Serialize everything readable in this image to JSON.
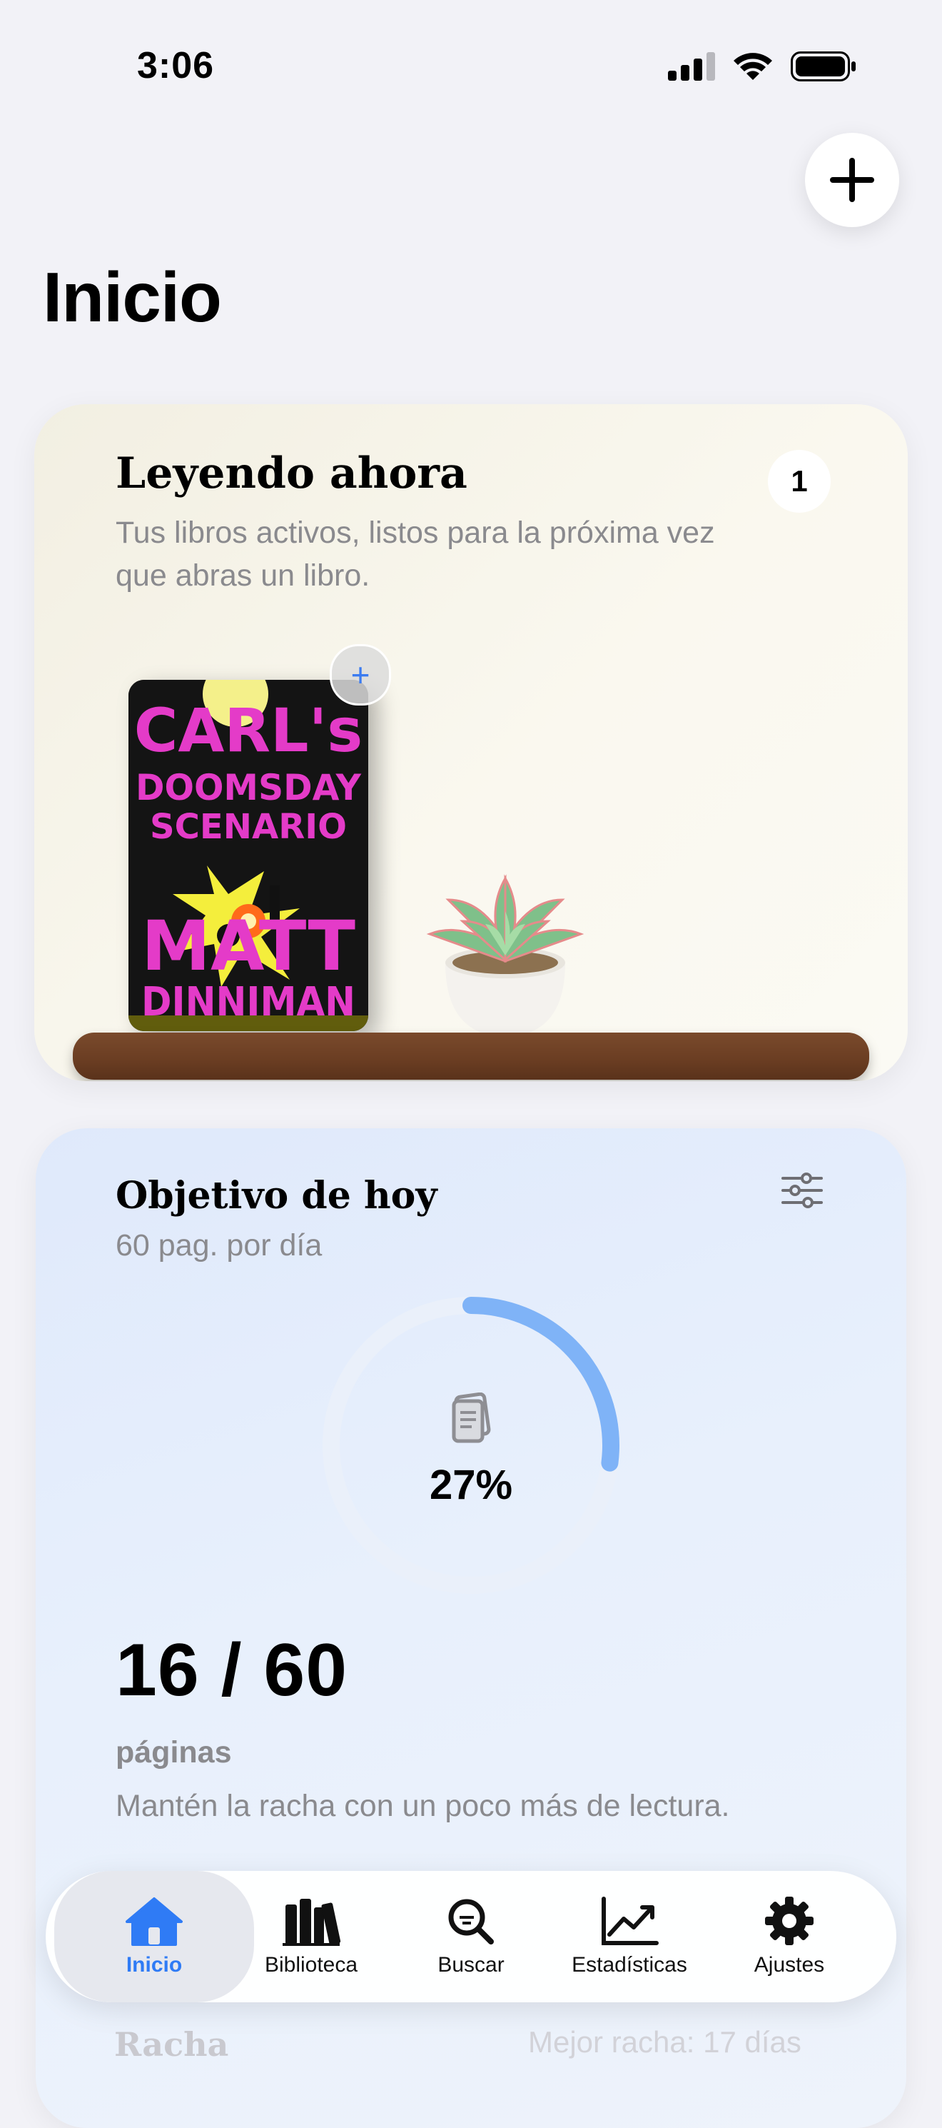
{
  "status_bar": {
    "time": "3:06"
  },
  "header": {
    "title": "Inicio"
  },
  "reading_now": {
    "title": "Leyendo ahora",
    "subtitle": "Tus libros activos, listos para la próxima vez que abras un libro.",
    "count": "1",
    "book": {
      "cover_lines": [
        "CARL's",
        "DOOMSDAY",
        "SCENARIO",
        "MATT",
        "DINNIMAN"
      ]
    }
  },
  "daily_goal": {
    "title": "Objetivo de hoy",
    "subtitle": "60 pag. por día",
    "percent_label": "27%",
    "progress": 0.27,
    "count": "16 / 60",
    "unit": "páginas",
    "message": "Mantén la racha con un poco más de lectura."
  },
  "peek": {
    "left": "Racha",
    "right": "Mejor racha: 17 días"
  },
  "tabbar": {
    "items": [
      {
        "label": "Inicio",
        "icon": "house-icon"
      },
      {
        "label": "Biblioteca",
        "icon": "books-icon"
      },
      {
        "label": "Buscar",
        "icon": "search-icon"
      },
      {
        "label": "Estadísticas",
        "icon": "chart-icon"
      },
      {
        "label": "Ajustes",
        "icon": "gear-icon"
      }
    ]
  },
  "colors": {
    "accent": "#2f7bf5",
    "ring": "#7fb3f7",
    "shelf": "#6a3d22"
  }
}
